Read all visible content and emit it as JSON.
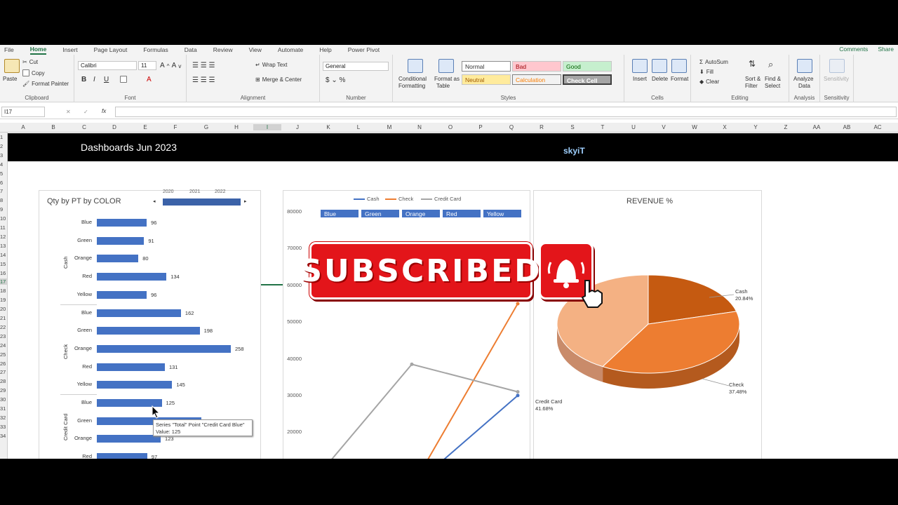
{
  "menu": [
    "File",
    "Home",
    "Insert",
    "Page Layout",
    "Formulas",
    "Data",
    "Review",
    "View",
    "Automate",
    "Help",
    "Power Pivot"
  ],
  "menu_active": "Home",
  "menu_right": {
    "comments": "Comments",
    "share": "Share"
  },
  "ribbon": {
    "clipboard": {
      "paste": "Paste",
      "cut": "Cut",
      "copy": "Copy",
      "format_painter": "Format Painter",
      "label": "Clipboard"
    },
    "font": {
      "name": "Calibri",
      "size": "11",
      "label": "Font"
    },
    "alignment": {
      "wrap": "Wrap Text",
      "merge": "Merge & Center",
      "label": "Alignment"
    },
    "number": {
      "format": "General",
      "label": "Number"
    },
    "styles": {
      "conditional": "Conditional",
      "conditional2": "Formatting",
      "format_as": "Format as",
      "format_as2": "Table",
      "normal": "Normal",
      "bad": "Bad",
      "good": "Good",
      "neutral": "Neutral",
      "calculation": "Calculation",
      "check_cell": "Check Cell",
      "label": "Styles"
    },
    "cells": {
      "insert": "Insert",
      "delete": "Delete",
      "format": "Format",
      "label": "Cells"
    },
    "editing": {
      "autosum": "AutoSum",
      "fill": "Fill",
      "clear": "Clear",
      "sort": "Sort &",
      "sort2": "Filter",
      "find": "Find &",
      "find2": "Select",
      "label": "Editing"
    },
    "analysis": {
      "analyze": "Analyze",
      "analyze2": "Data",
      "label": "Analysis"
    },
    "sensitivity": {
      "sens": "Sensitivity",
      "label": "Sensitivity"
    }
  },
  "formula_bar": {
    "cell": "I17",
    "fx": "fx"
  },
  "columns": [
    "A",
    "B",
    "C",
    "D",
    "E",
    "F",
    "G",
    "H",
    "I",
    "J",
    "K",
    "L",
    "M",
    "N",
    "O",
    "P",
    "Q",
    "R",
    "S",
    "T",
    "U",
    "V",
    "W",
    "X",
    "Y",
    "Z",
    "AA",
    "AB",
    "AC"
  ],
  "rows": [
    "1",
    "2",
    "3",
    "4",
    "5",
    "6",
    "7",
    "8",
    "9",
    "10",
    "11",
    "12",
    "13",
    "14",
    "15",
    "16",
    "17",
    "18",
    "19",
    "20",
    "21",
    "22",
    "23",
    "24",
    "25",
    "26",
    "27",
    "28",
    "29",
    "30",
    "31",
    "32",
    "33",
    "34"
  ],
  "banner": {
    "title": "Dashboards Jun 2023",
    "logo": "skyiT"
  },
  "bar_chart": {
    "title": "Qty by PT by COLOR",
    "timeline": [
      "2020",
      "2021",
      "2022"
    ],
    "groups": [
      "Cash",
      "Check",
      "Credit Card"
    ]
  },
  "line_chart": {
    "legend": [
      "Cash",
      "Check",
      "Credit Card"
    ],
    "slicers": [
      "Blue",
      "Green",
      "Orange",
      "Red",
      "Yellow"
    ]
  },
  "pie_chart": {
    "title": "REVENUE %",
    "labels": [
      {
        "name": "Cash",
        "pct": "20.84%"
      },
      {
        "name": "Check",
        "pct": "37.48%"
      },
      {
        "name": "Credit Card",
        "pct": "41.68%"
      }
    ]
  },
  "overlay": {
    "subscribe": "SUBSCRIBED"
  },
  "tooltip": {
    "line1": "Series \"Total\" Point \"Credit Card Blue\"",
    "line2": "Value: 125"
  },
  "colors": {
    "bar": "#4472c4",
    "cash": "#4472c4",
    "check": "#ed7d31",
    "credit_card": "#a5a5a5",
    "excel_green": "#217346"
  },
  "chart_data": [
    {
      "type": "bar",
      "title": "Qty by PT by COLOR",
      "categories": [
        "Blue",
        "Green",
        "Orange",
        "Red",
        "Yellow",
        "Blue",
        "Green",
        "Orange",
        "Red",
        "Yellow",
        "Blue",
        "Green",
        "Orange",
        "Red"
      ],
      "groups": [
        {
          "name": "Cash",
          "range": [
            0,
            5
          ]
        },
        {
          "name": "Check",
          "range": [
            5,
            10
          ]
        },
        {
          "name": "Credit Card",
          "range": [
            10,
            14
          ]
        }
      ],
      "values": [
        96,
        91,
        80,
        134,
        96,
        162,
        198,
        258,
        131,
        145,
        125,
        201,
        123,
        97
      ],
      "value_labels": [
        "96",
        "91",
        "80",
        "134",
        "96",
        "162",
        "198",
        "258",
        "131",
        "145",
        "125",
        "201",
        "123",
        "97"
      ]
    },
    {
      "type": "line",
      "yticks": [
        "80000",
        "70000",
        "60000",
        "50000",
        "40000",
        "30000",
        "20000",
        "10000"
      ],
      "ylim": [
        0,
        80000
      ],
      "series": [
        {
          "name": "Cash",
          "values": [
            4500,
            5000,
            30000
          ]
        },
        {
          "name": "Check",
          "values": [
            0,
            5000,
            55000
          ]
        },
        {
          "name": "Credit Card",
          "values": [
            4500,
            38500,
            31000
          ]
        }
      ]
    },
    {
      "type": "pie",
      "title": "REVENUE %",
      "slices": [
        {
          "name": "Cash",
          "value": 20.84
        },
        {
          "name": "Check",
          "value": 37.48
        },
        {
          "name": "Credit Card",
          "value": 41.68
        }
      ]
    }
  ]
}
